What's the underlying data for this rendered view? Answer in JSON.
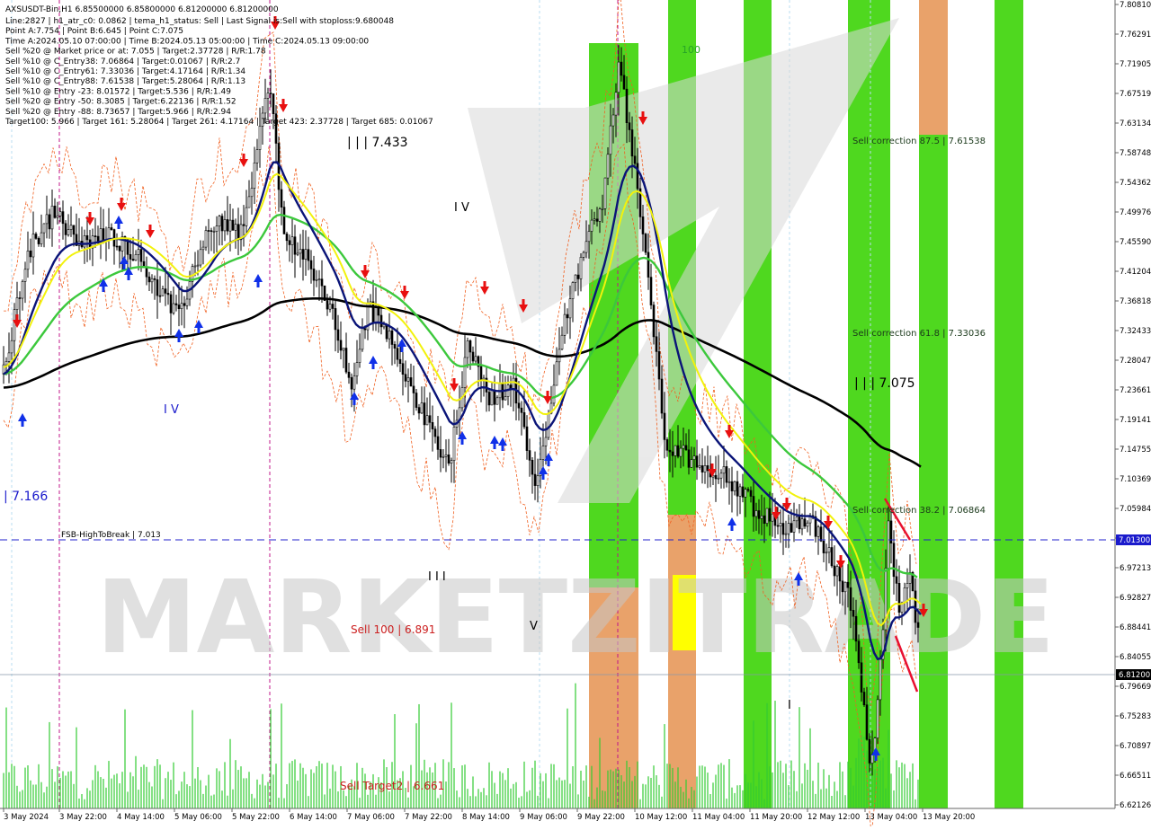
{
  "chart_data": {
    "type": "candlestick",
    "symbol_header": "AXSUSDT-Bin,H1  6.85500000 6.85800000 6.81200000 6.81200000",
    "info_lines": [
      "Line:2827  |  h1_atr_c0: 0.0862  |  tema_h1_status: Sell  |  Last Signal is:Sell with stoploss:9.680048",
      "Point A:7.754  |  Point B:6.645  |  Point C:7.075",
      "Time A:2024.05.10 07:00:00  |  Time B:2024.05.13 05:00:00  |  Time C:2024.05.13 09:00:00",
      "Sell %20 @ Market price or at: 7.055  |  Target:2.37728  |  R/R:1.78",
      "Sell %10 @ C_Entry38: 7.06864  |  Target:0.01067  |  R/R:2.7",
      "Sell %10 @ C_Entry61: 7.33036  |  Target:4.17164  |  R/R:1.34",
      "Sell %10 @ C_Entry88: 7.61538  |  Target:5.28064  |  R/R:1.13",
      "Sell %10 @ Entry -23: 8.01572  |  Target:5.536  |  R/R:1.49",
      "Sell %20 @ Entry -50: 8.3085  |  Target:6.22136  |  R/R:1.52",
      "Sell %20 @ Entry -88: 8.73657  |  Target:5.966  |  R/R:2.94",
      "Target100: 5.966  |  Target 161: 5.28064  |  Target 261: 4.17164  |  Target 423: 2.37728  |  Target 685: 0.01067"
    ],
    "x_tick_labels": [
      "3 May 2024",
      "3 May 22:00",
      "4 May 14:00",
      "5 May 06:00",
      "5 May 22:00",
      "6 May 14:00",
      "7 May 06:00",
      "7 May 22:00",
      "8 May 14:00",
      "9 May 06:00",
      "9 May 22:00",
      "10 May 12:00",
      "11 May 04:00",
      "11 May 20:00",
      "12 May 12:00",
      "13 May 04:00",
      "13 May 20:00"
    ],
    "y_tick_labels": [
      "7.80810",
      "7.76291",
      "7.71905",
      "7.67519",
      "7.63134",
      "7.58748",
      "7.54362",
      "7.49976",
      "7.45590",
      "7.41204",
      "7.36818",
      "7.32433",
      "7.28047",
      "7.23661",
      "7.19141",
      "7.14755",
      "7.10369",
      "7.05984",
      "7.01300",
      "6.97213",
      "6.92827",
      "6.88441",
      "6.84055",
      "6.79669",
      "6.75283",
      "6.70897",
      "6.66511",
      "6.62126"
    ],
    "ylim": [
      6.62126,
      7.8081
    ],
    "y_scale": "linear",
    "current_price": "6.81200",
    "fsb_price": "7.01300",
    "annotations": {
      "fsb_label": "FSB-HighToBreak | 7.013",
      "sell100": "Sell 100 | 6.891",
      "sell_target2": "Sell Target2 | 6.661",
      "corr875": "Sell correction 87.5 | 7.61538",
      "corr618": "Sell correction 61.8 | 7.33036",
      "corr382": "Sell correction 38.2 | 7.06864",
      "wave_c": "| | | 7.075",
      "wave_a": "| | | 7.433",
      "wave_left": "| 7.166",
      "label_100": "100",
      "wave_iv1": "I V",
      "wave_iv2": "I V",
      "wave_iii": "I I I",
      "wave_v": "V",
      "wave_i": "I"
    },
    "watermark": "MARKETZITRADE",
    "colors": {
      "zone_green": "#4fd81f",
      "zone_orange": "#e9a26a",
      "zone_yellow": "#ffff00",
      "ma_black": "#000000",
      "ma_green": "#3cc83c",
      "ma_navy": "#0a1478",
      "ma_yellow": "#f2f20c",
      "candle": "#000000",
      "volume": "#33cc33",
      "sell_arrow": "#e81010",
      "buy_arrow": "#1030e8",
      "fsb_line": "#1a1acc",
      "vertical_magenta": "#c0178a"
    }
  }
}
